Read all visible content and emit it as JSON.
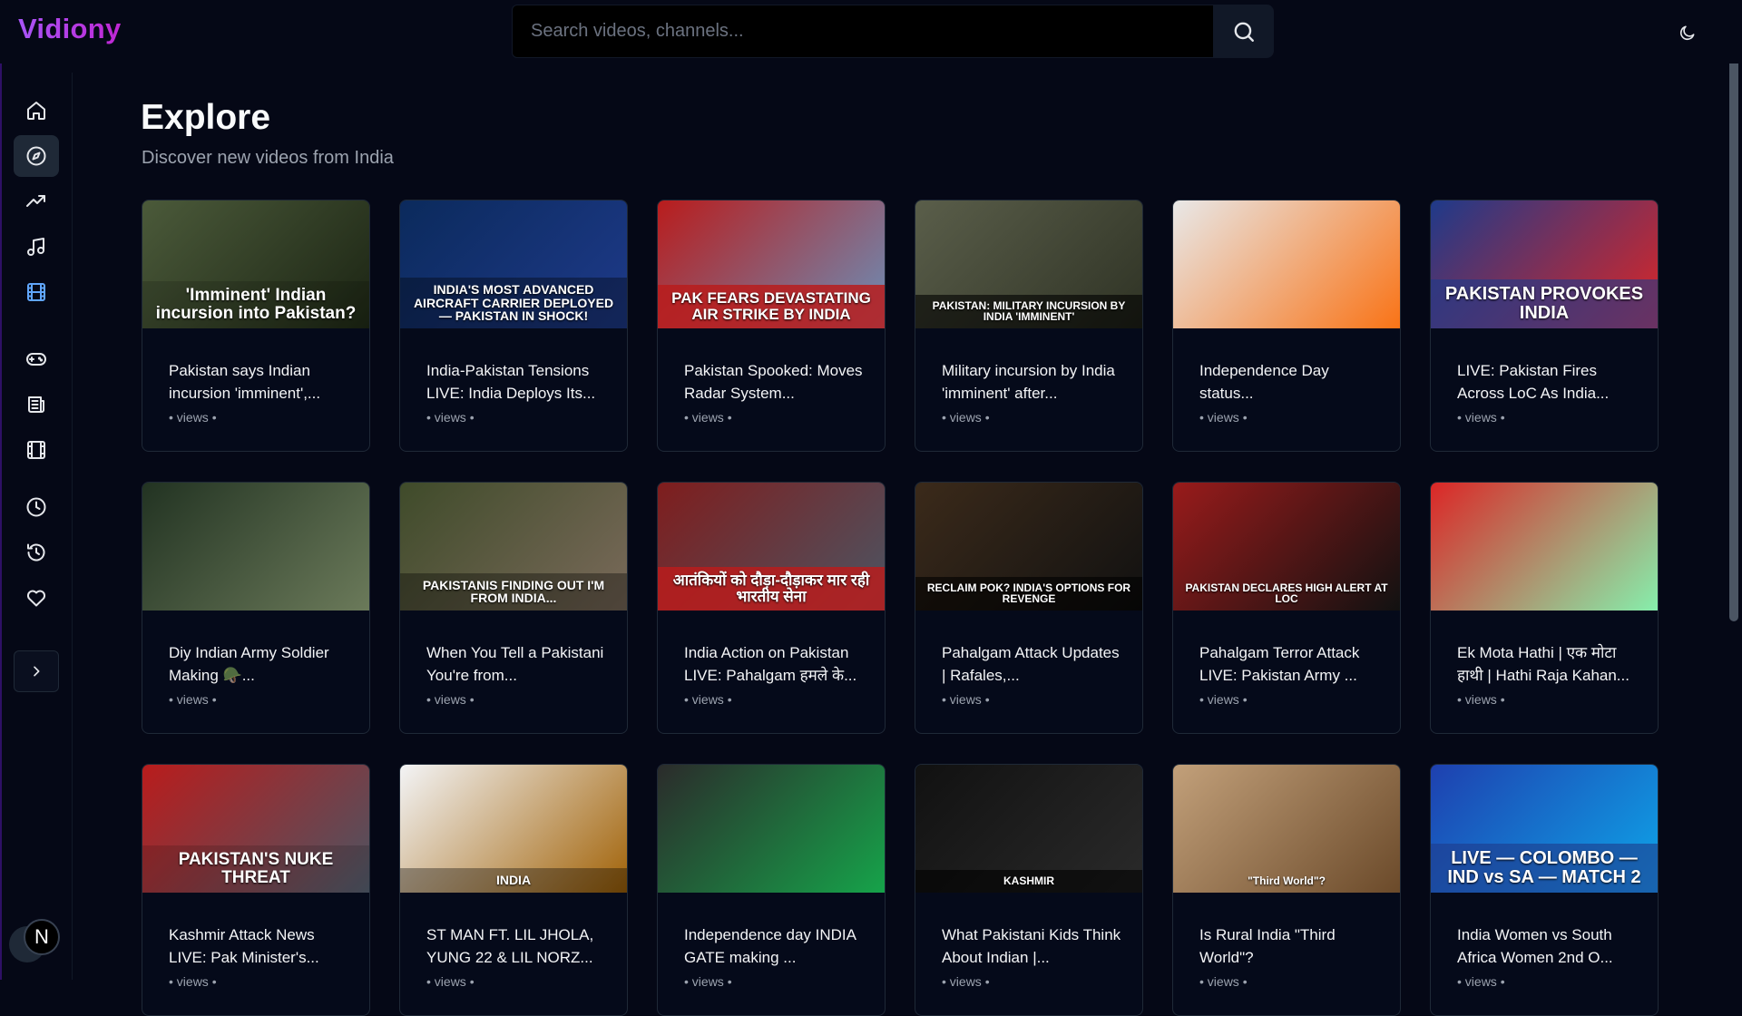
{
  "app": {
    "logo": "Vidiony",
    "search_placeholder": "Search videos, channels..."
  },
  "colors": {
    "background": "#050816",
    "brand_gradient": [
      "#a855f7",
      "#c026d3"
    ],
    "nav_icon_default": "#e5e7eb",
    "nav_icon_active": "#60a5fa"
  },
  "sidebar": {
    "items": [
      {
        "icon": "home-icon",
        "active": false
      },
      {
        "icon": "compass-icon",
        "active": true
      },
      {
        "icon": "trending-icon",
        "active": false
      },
      {
        "icon": "music-icon",
        "active": false
      },
      {
        "icon": "film-icon",
        "active": false,
        "highlight": true
      },
      {
        "icon": "gamepad-icon",
        "active": false
      },
      {
        "icon": "newspaper-icon",
        "active": false
      },
      {
        "icon": "movie-icon",
        "active": false
      },
      {
        "icon": "clock-icon",
        "active": false
      },
      {
        "icon": "history-icon",
        "active": false
      },
      {
        "icon": "heart-icon",
        "active": false
      }
    ],
    "expand_icon": "chevron-right-icon",
    "avatar_letter": "N"
  },
  "main": {
    "title": "Explore",
    "subtitle": "Discover new videos from India",
    "meta_text": "• views •",
    "videos": [
      {
        "title": "Pakistan says Indian incursion 'imminent',...",
        "thumb_text": "'Imminent' Indian incursion into Pakistan?",
        "thumb_colors": [
          "#4b5a3a",
          "#1b2413"
        ]
      },
      {
        "title": "India-Pakistan Tensions LIVE: India Deploys Its...",
        "thumb_text": "INDIA'S MOST ADVANCED AIRCRAFT CARRIER DEPLOYED — PAKISTAN IN SHOCK!",
        "thumb_colors": [
          "#0b2a5c",
          "#1e3a8a"
        ]
      },
      {
        "title": "Pakistan Spooked: Moves Radar System...",
        "thumb_text": "PAK FEARS DEVASTATING AIR STRIKE BY INDIA",
        "thumb_colors": [
          "#b91c1c",
          "#6b8fb8"
        ]
      },
      {
        "title": "Military incursion by India 'imminent' after...",
        "thumb_text": "PAKISTAN: MILITARY INCURSION BY INDIA 'IMMINENT'",
        "thumb_colors": [
          "#5a5e4a",
          "#2f3325"
        ]
      },
      {
        "title": "Independence Day status...",
        "thumb_text": "",
        "thumb_colors": [
          "#e8e8e8",
          "#f97316"
        ]
      },
      {
        "title": "LIVE: Pakistan Fires Across LoC As India...",
        "thumb_text": "PAKISTAN PROVOKES INDIA",
        "thumb_colors": [
          "#1e3a8a",
          "#dc2626"
        ]
      },
      {
        "title": "Diy Indian Army Soldier Making 🪖...",
        "thumb_text": "",
        "thumb_colors": [
          "#223322",
          "#6b7a5a"
        ]
      },
      {
        "title": "When You Tell a Pakistani You're from...",
        "thumb_text": "PAKISTANIS FINDING OUT I'M FROM INDIA...",
        "thumb_colors": [
          "#3f4b2a",
          "#7a6a5a"
        ]
      },
      {
        "title": "India Action on Pakistan LIVE: Pahalgam हमले के...",
        "thumb_text": "आतंकियों को दौड़ा-दौड़ाकर मार रही भारतीय सेना",
        "thumb_colors": [
          "#7f1d1d",
          "#4b5563"
        ]
      },
      {
        "title": "Pahalgam Attack Updates | Rafales,...",
        "thumb_text": "RECLAIM POK? INDIA'S OPTIONS FOR REVENGE",
        "thumb_colors": [
          "#3b2a1a",
          "#111111"
        ]
      },
      {
        "title": "Pahalgam Terror Attack LIVE: Pakistan Army ...",
        "thumb_text": "PAKISTAN DECLARES HIGH ALERT AT LOC",
        "thumb_colors": [
          "#991b1b",
          "#111111"
        ]
      },
      {
        "title": "Ek Mota Hathi | एक मोटा हाथी | Hathi Raja Kahan...",
        "thumb_text": "",
        "thumb_colors": [
          "#dc2626",
          "#86efac"
        ]
      },
      {
        "title": "Kashmir Attack News LIVE: Pak Minister's...",
        "thumb_text": "PAKISTAN'S NUKE THREAT",
        "thumb_colors": [
          "#b91c1c",
          "#4b5563"
        ]
      },
      {
        "title": "ST MAN FT. LIL JHOLA, YUNG 22 & LIL NORZ...",
        "thumb_text": "INDIA",
        "thumb_colors": [
          "#f3f4f6",
          "#a16207"
        ]
      },
      {
        "title": "Independence day INDIA GATE making ...",
        "thumb_text": "",
        "thumb_colors": [
          "#2b2b2b",
          "#16a34a"
        ]
      },
      {
        "title": "What Pakistani Kids Think About Indian |...",
        "thumb_text": "KASHMIR",
        "thumb_colors": [
          "#111111",
          "#2a2a2a"
        ]
      },
      {
        "title": "Is Rural India \"Third World\"?",
        "thumb_text": "\"Third World\"?",
        "thumb_colors": [
          "#c2a07a",
          "#6b4a2a"
        ]
      },
      {
        "title": "India Women vs South Africa Women 2nd O...",
        "thumb_text": "LIVE — COLOMBO — IND vs SA — MATCH 2",
        "thumb_colors": [
          "#1e40af",
          "#0ea5e9"
        ]
      }
    ]
  }
}
